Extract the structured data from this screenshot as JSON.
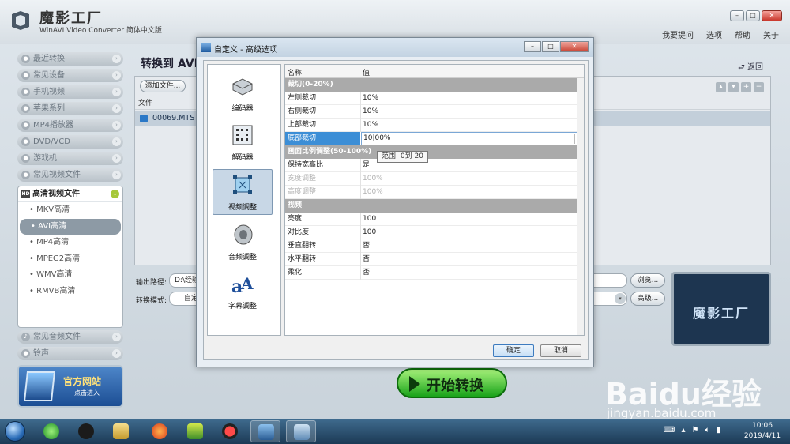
{
  "app": {
    "logo_text": "魔影工厂",
    "subtitle": "WinAVI Video Converter 简体中文版",
    "menu": [
      "我要提问",
      "选项",
      "帮助",
      "关于"
    ]
  },
  "sidebar": {
    "items": [
      {
        "label": "最近转换"
      },
      {
        "label": "常见设备"
      },
      {
        "label": "手机视频"
      },
      {
        "label": "苹果系列"
      },
      {
        "label": "MP4播放器"
      },
      {
        "label": "DVD/VCD"
      },
      {
        "label": "游戏机"
      },
      {
        "label": "常见视频文件"
      }
    ],
    "expanded": {
      "label": "高清视频文件",
      "badge": "HD",
      "sub_items": [
        "MKV高清",
        "AVI高清",
        "MP4高清",
        "MPEG2高清",
        "WMV高清",
        "RMVB高清"
      ],
      "selected": "AVI高清"
    },
    "bottom_items": [
      {
        "label": "常见音频文件"
      },
      {
        "label": "铃声"
      }
    ],
    "promo": {
      "title": "官方网站",
      "sub": "点击进入"
    }
  },
  "main": {
    "title": "转换到 AVI",
    "back_label": "返回",
    "add_file_label": "添加文件...",
    "file_column": "文件",
    "files": [
      "00069.MTS"
    ],
    "output_label": "输出路径:",
    "output_value": "D:\\经验",
    "browse_label": "浏览...",
    "mode_label": "转换模式:",
    "mode_value": "自定",
    "advanced_label": "高级...",
    "preview_logo": "魔影工厂",
    "start_label": "开始转换"
  },
  "dialog": {
    "title": "自定义 - 高级选项",
    "categories": [
      {
        "label": "编码器",
        "icon": "encoder-icon"
      },
      {
        "label": "解码器",
        "icon": "decoder-icon"
      },
      {
        "label": "视频调整",
        "icon": "video-adjust-icon"
      },
      {
        "label": "音频调整",
        "icon": "speaker-icon"
      },
      {
        "label": "字幕调整",
        "icon": "subtitle-icon"
      }
    ],
    "selected_category": "视频调整",
    "grid_header": {
      "name": "名称",
      "value": "值"
    },
    "groups": {
      "crop": "裁切(0-20%)",
      "aspect": "画面比例调整(50-100%)",
      "video": "视频"
    },
    "rows": {
      "left_crop": {
        "k": "左侧裁切",
        "v": "10%"
      },
      "right_crop": {
        "k": "右侧裁切",
        "v": "10%"
      },
      "top_crop": {
        "k": "上部裁切",
        "v": "10%"
      },
      "bottom_crop": {
        "k": "底部裁切",
        "v": "10|00%"
      },
      "keep_ratio": {
        "k": "保持宽高比",
        "v": "是"
      },
      "width_adj": {
        "k": "宽度调整",
        "v": "100%"
      },
      "height_adj": {
        "k": "高度调整",
        "v": "100%"
      },
      "brightness": {
        "k": "亮度",
        "v": "100"
      },
      "contrast": {
        "k": "对比度",
        "v": "100"
      },
      "vflip": {
        "k": "垂直翻转",
        "v": "否"
      },
      "hflip": {
        "k": "水平翻转",
        "v": "否"
      },
      "soften": {
        "k": "柔化",
        "v": "否"
      }
    },
    "tooltip": "范围: 0到 20",
    "ok_label": "确定",
    "cancel_label": "取消"
  },
  "taskbar": {
    "time": "10:06",
    "date": "2019/4/11"
  },
  "watermark": {
    "brand": "Baidu经验",
    "site": "jingyan.baidu.com"
  }
}
